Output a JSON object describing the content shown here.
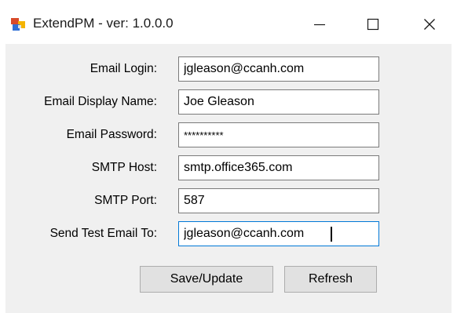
{
  "window": {
    "title": "ExtendPM - ver: 1.0.0.0",
    "icon": "app-window-icon",
    "controls": {
      "minimize_icon": "minimize-icon",
      "maximize_icon": "maximize-icon",
      "close_icon": "close-icon"
    }
  },
  "form": {
    "fields": [
      {
        "label": "Email Login:",
        "value": "jgleason@ccanh.com"
      },
      {
        "label": "Email Display Name:",
        "value": "Joe Gleason"
      },
      {
        "label": "Email Password:",
        "value": "**********"
      },
      {
        "label": "SMTP Host:",
        "value": "smtp.office365.com"
      },
      {
        "label": "SMTP Port:",
        "value": "587"
      },
      {
        "label": "Send Test Email To:",
        "value": "jgleason@ccanh.com"
      }
    ],
    "buttons": {
      "save_label": "Save/Update",
      "refresh_label": "Refresh"
    }
  },
  "colors": {
    "client_background": "#f0f0f0",
    "input_border": "#7a7a7a",
    "focus_border": "#0078d7",
    "button_face": "#e1e1e1"
  }
}
